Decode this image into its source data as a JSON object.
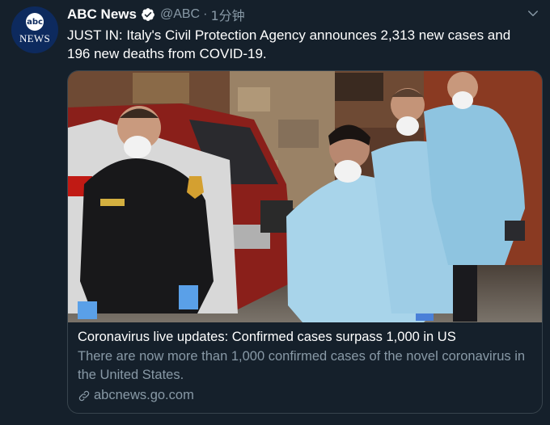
{
  "tweet": {
    "avatar_text": "NEWS",
    "avatar_logo": "abc",
    "display_name": "ABC News",
    "verified": true,
    "handle": "@ABC",
    "separator": "·",
    "time": "1分钟",
    "text": "JUST IN: Italy's Civil Protection Agency announces 2,313 new cases and 196 new deaths from COVID-19."
  },
  "card": {
    "title": "Coronavirus live updates: Confirmed cases surpass 1,000 in US",
    "description": "There are now more than 1,000 confirmed cases of the novel coronavirus in the United States.",
    "domain": "abcnews.go.com",
    "link_icon": "link-icon"
  },
  "colors": {
    "background": "#15202b",
    "secondary_text": "#8899a6",
    "verified_blue": "#1da1f2",
    "border": "#38444d"
  }
}
